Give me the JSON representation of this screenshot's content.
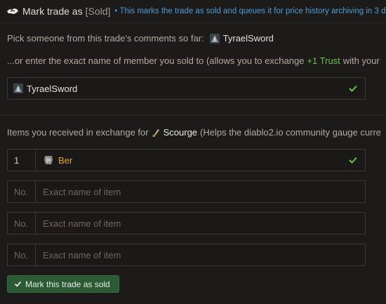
{
  "header": {
    "title": "Mark trade as",
    "tag": "[Sold]",
    "note": "• This marks the trade as sold and queues it for price history archiving in 3 da"
  },
  "pick": {
    "prompt": "Pick someone from this trade's comments so far:",
    "user": "TyraelSword"
  },
  "enter": {
    "prefix": "...or enter the exact name of member you sold to (allows you to exchange",
    "trust": "+1 Trust",
    "suffix": "with your"
  },
  "buyer_field": {
    "value": "TyraelSword"
  },
  "items_section": {
    "prefix": "Items you received in exchange for",
    "item": "Scourge",
    "suffix": "(Helps the diablo2.io community gauge curre"
  },
  "item_rows": [
    {
      "qty": "1",
      "name": "Ber",
      "filled": true
    },
    {
      "qty_placeholder": "No.",
      "name_placeholder": "Exact name of item"
    },
    {
      "qty_placeholder": "No.",
      "name_placeholder": "Exact name of item"
    },
    {
      "qty_placeholder": "No.",
      "name_placeholder": "Exact name of item"
    }
  ],
  "submit": {
    "label": "Mark this trade as sold"
  },
  "colors": {
    "background": "#1c1b1a",
    "link_blue": "#4f9bd6",
    "trust_green": "#6bc248",
    "rune_orange": "#e9a23b",
    "button_green": "#2c5a35"
  }
}
